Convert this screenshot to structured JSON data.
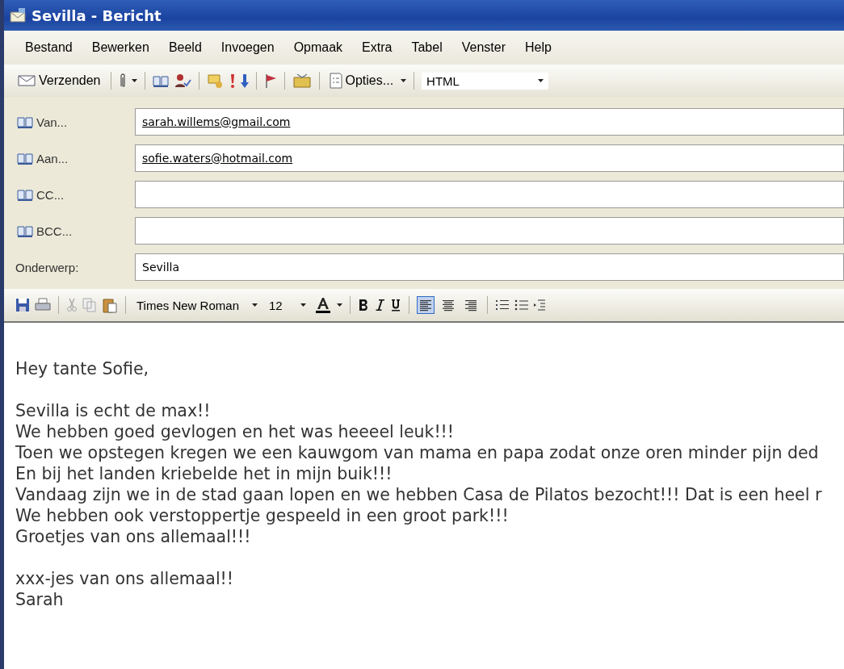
{
  "window": {
    "title": "Sevilla - Bericht"
  },
  "menu": [
    "Bestand",
    "Bewerken",
    "Beeld",
    "Invoegen",
    "Opmaak",
    "Extra",
    "Tabel",
    "Venster",
    "Help"
  ],
  "toolbar": {
    "send": "Verzenden",
    "options": "Opties...",
    "format": "HTML"
  },
  "address_fields": [
    {
      "label": "Van...",
      "value": "sarah.willems@gmail.com"
    },
    {
      "label": "Aan...",
      "value": "sofie.waters@hotmail.com"
    },
    {
      "label": "CC..."
    },
    {
      "label": "BCC..."
    }
  ],
  "subject": {
    "label": "Onderwerp:",
    "value": "Sevilla"
  },
  "format_bar": {
    "font": "Times New Roman",
    "size": "12",
    "alignment": [
      {
        "kind": "left",
        "selected": true
      },
      {
        "kind": "center",
        "selected": false
      },
      {
        "kind": "right",
        "selected": false
      }
    ]
  },
  "body": {
    "paragraphs": [
      {
        "lines": [
          "Hey tante Sofie,"
        ]
      },
      {
        "lines": [
          "Sevilla is echt de max!!",
          "We hebben goed gevlogen en het was heeeel leuk!!!",
          "Toen we opstegen kregen we een kauwgom van mama en papa zodat onze oren minder pijn ded",
          "En bij het landen kriebelde het in mijn buik!!!",
          "Vandaag zijn we in de stad gaan lopen en we hebben Casa de Pilatos bezocht!!! Dat is een heel r",
          "We hebben ook verstoppertje gespeeld in een groot park!!!",
          "Groetjes van ons allemaal!!!"
        ]
      },
      {
        "lines": [
          "xxx-jes van ons allemaal!!",
          "Sarah"
        ]
      }
    ]
  }
}
